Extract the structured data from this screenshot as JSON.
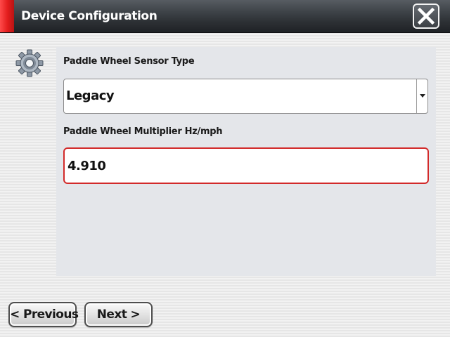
{
  "window": {
    "title": "Device Configuration",
    "close_icon": "close-x-icon",
    "accent_color": "#e21c1c"
  },
  "sidebar": {
    "icon": "gear-icon"
  },
  "form": {
    "sensor_type": {
      "label": "Paddle Wheel Sensor Type",
      "selected": "Legacy"
    },
    "multiplier": {
      "label": "Paddle Wheel Multiplier Hz/mph",
      "value": "4.910",
      "border_color": "#d22a2a"
    }
  },
  "navigation": {
    "previous_label": "< Previous",
    "next_label": "Next >"
  }
}
